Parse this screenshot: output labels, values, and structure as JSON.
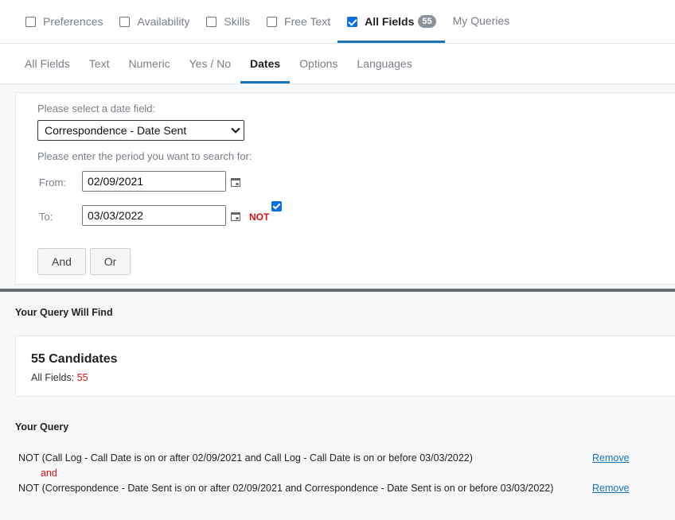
{
  "top_tabs": [
    {
      "label": "Preferences",
      "checked": false,
      "has_checkbox": true
    },
    {
      "label": "Availability",
      "checked": false,
      "has_checkbox": true
    },
    {
      "label": "Skills",
      "checked": false,
      "has_checkbox": true
    },
    {
      "label": "Free Text",
      "checked": false,
      "has_checkbox": true
    },
    {
      "label": "All Fields",
      "checked": true,
      "has_checkbox": true,
      "badge": "55",
      "active": true
    },
    {
      "label": "My Queries",
      "has_checkbox": false
    }
  ],
  "sub_tabs": [
    {
      "label": "All Fields"
    },
    {
      "label": "Text"
    },
    {
      "label": "Numeric"
    },
    {
      "label": "Yes / No"
    },
    {
      "label": "Dates",
      "active": true
    },
    {
      "label": "Options"
    },
    {
      "label": "Languages"
    }
  ],
  "form": {
    "date_field_label": "Please select a date field:",
    "date_field_value": "Correspondence - Date Sent",
    "period_label": "Please enter the period you want to search for:",
    "from_label": "From:",
    "from_value": "02/09/2021",
    "to_label": "To:",
    "to_value": "03/03/2022",
    "not_label": "NOT",
    "not_checked": true,
    "and_button": "And",
    "or_button": "Or"
  },
  "results": {
    "title": "Your Query Will Find",
    "count_text": "55 Candidates",
    "sub_label": "All Fields:",
    "sub_value": "55"
  },
  "query": {
    "title": "Your Query",
    "lines": [
      "NOT (Call Log - Call Date is on or after 02/09/2021 and Call Log - Call Date is on or before 03/03/2022)",
      "NOT (Correspondence - Date Sent is on or after 02/09/2021 and Correspondence - Date Sent is on or before 03/03/2022)"
    ],
    "connector": "and",
    "remove_label": "Remove"
  },
  "colors": {
    "accent": "#1a73b8",
    "checkbox": "#0b6fe0",
    "not_red": "#dd1111"
  }
}
